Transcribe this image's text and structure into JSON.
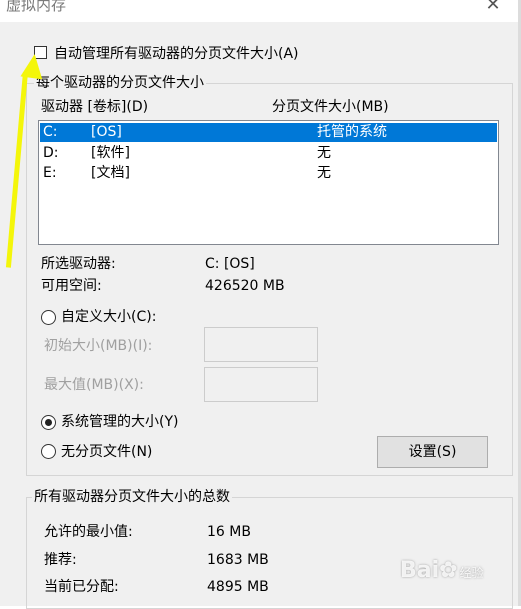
{
  "window": {
    "title": "虚拟内存"
  },
  "auto_manage": {
    "label": "自动管理所有驱动器的分页文件大小(A)",
    "checked": false
  },
  "drives_group": {
    "legend": "每个驱动器的分页文件大小",
    "col_drive": "驱动器 [卷标](D)",
    "col_size": "分页文件大小(MB)",
    "rows": [
      {
        "drive": "C:",
        "label": "[OS]",
        "size": "托管的系统",
        "selected": true
      },
      {
        "drive": "D:",
        "label": "[软件]",
        "size": "无",
        "selected": false
      },
      {
        "drive": "E:",
        "label": "[文档]",
        "size": "无",
        "selected": false
      }
    ],
    "selected_drive_label": "所选驱动器:",
    "selected_drive_value": "C:  [OS]",
    "free_space_label": "可用空间:",
    "free_space_value": "426520 MB",
    "custom_size_label": "自定义大小(C):",
    "initial_size_label": "初始大小(MB)(I):",
    "max_size_label": "最大值(MB)(X):",
    "system_managed_label": "系统管理的大小(Y)",
    "no_paging_label": "无分页文件(N)",
    "set_button": "设置(S)",
    "selected_option": "system_managed"
  },
  "totals_group": {
    "legend": "所有驱动器分页文件大小的总数",
    "min_label": "允许的最小值:",
    "min_value": "16 MB",
    "recommended_label": "推荐:",
    "recommended_value": "1683 MB",
    "current_label": "当前已分配:",
    "current_value": "4895 MB"
  },
  "colors": {
    "selection": "#0078d7",
    "annotation_arrow": "#f4f60a"
  },
  "watermark": {
    "text": "Bai",
    "suffix": "经验",
    "icon": "paw-icon"
  }
}
